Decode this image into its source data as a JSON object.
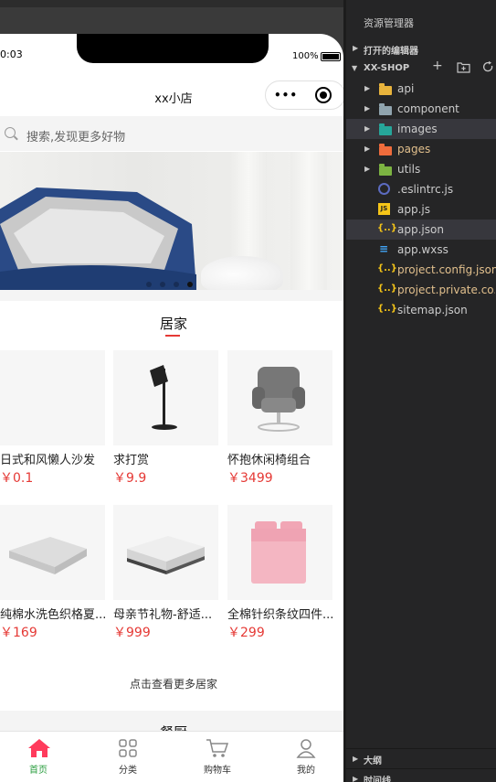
{
  "status_bar": {
    "time": "0:03",
    "battery": "100%"
  },
  "nav": {
    "title": "xx小店",
    "capsule_dots": "•••"
  },
  "search": {
    "placeholder": "搜索,发现更多好物"
  },
  "banner": {
    "dot_count": 4,
    "active_dot": 3
  },
  "section": {
    "title": "居家",
    "products": [
      {
        "name": "日式和风懒人沙发",
        "price": "￥0.1"
      },
      {
        "name": "求打赏",
        "price": "￥9.9"
      },
      {
        "name": "怀抱休闲椅组合",
        "price": "￥3499"
      },
      {
        "name": "纯棉水洗色织格夏...",
        "price": "￥169"
      },
      {
        "name": "母亲节礼物-舒适...",
        "price": "￥999"
      },
      {
        "name": "全棉针织条纹四件...",
        "price": "￥299"
      }
    ],
    "more_link": "点击查看更多居家"
  },
  "next_section": {
    "title": "餐厨"
  },
  "tabbar": {
    "items": [
      {
        "label": "首页",
        "icon": "home-icon",
        "active": true
      },
      {
        "label": "分类",
        "icon": "grid-icon",
        "active": false
      },
      {
        "label": "购物车",
        "icon": "cart-icon",
        "active": false
      },
      {
        "label": "我的",
        "icon": "user-icon",
        "active": false
      }
    ]
  },
  "explorer": {
    "title": "资源管理器",
    "open_editors": "打开的编辑器",
    "project": "XX-SHOP",
    "tree": [
      {
        "name": "api",
        "kind": "folder",
        "color": "#e8b33c"
      },
      {
        "name": "component",
        "kind": "folder",
        "color": "#90a4ae"
      },
      {
        "name": "images",
        "kind": "folder",
        "color": "#26a69a"
      },
      {
        "name": "pages",
        "kind": "folder",
        "color": "#ef6c3c"
      },
      {
        "name": "utils",
        "kind": "folder",
        "color": "#7cb342"
      },
      {
        "name": ".eslintrc.js",
        "kind": "file",
        "icon": "eslint-icon"
      },
      {
        "name": "app.js",
        "kind": "file",
        "icon": "js-icon"
      },
      {
        "name": "app.json",
        "kind": "file",
        "icon": "json-icon"
      },
      {
        "name": "app.wxss",
        "kind": "file",
        "icon": "css-icon"
      },
      {
        "name": "project.config.json",
        "kind": "file",
        "icon": "json-icon"
      },
      {
        "name": "project.private.co...",
        "kind": "file",
        "icon": "json-icon"
      },
      {
        "name": "sitemap.json",
        "kind": "file",
        "icon": "json-icon"
      }
    ],
    "outline": "大纲",
    "timeline": "时间线"
  },
  "colors": {
    "price": "#e53935",
    "tab_active": "#2a9d3f",
    "home_icon": "#ff3b5c",
    "modified_file": "#e2c08d"
  }
}
